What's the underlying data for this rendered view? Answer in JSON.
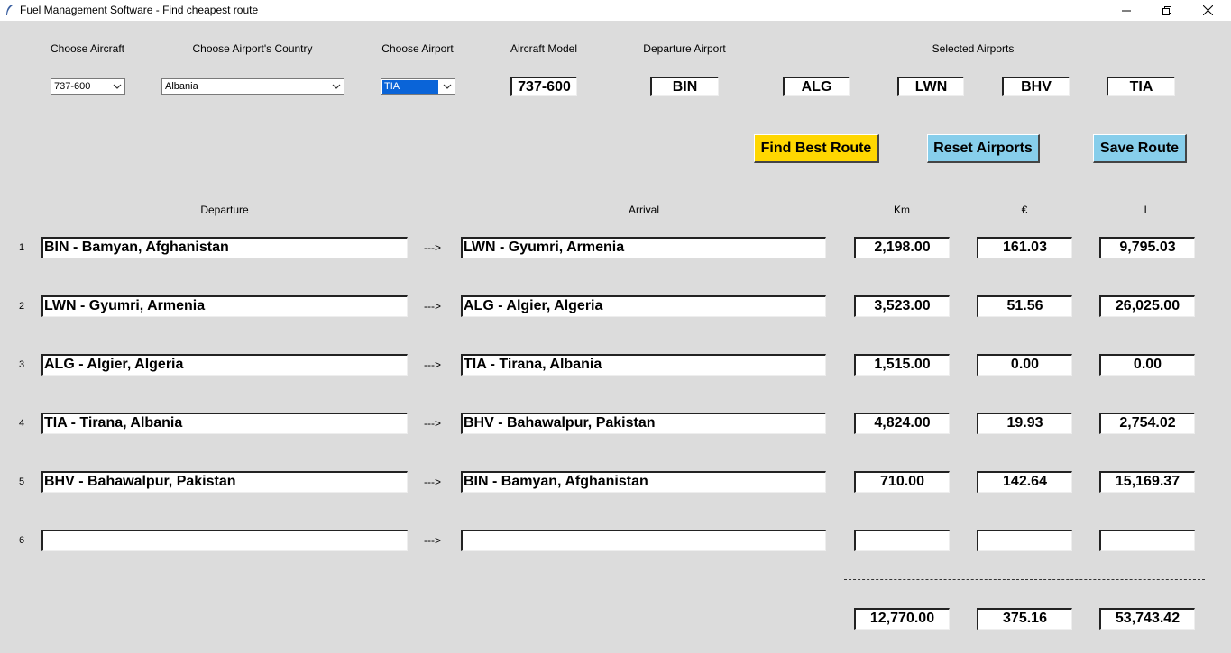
{
  "window": {
    "title": "Fuel Management Software - Find cheapest route"
  },
  "labels": {
    "choose_aircraft": "Choose Aircraft",
    "choose_country": "Choose Airport's Country",
    "choose_airport": "Choose Airport",
    "aircraft_model": "Aircraft Model",
    "departure_airport": "Departure Airport",
    "selected_airports": "Selected Airports"
  },
  "selectors": {
    "aircraft": "737-600",
    "country": "Albania",
    "airport": "TIA"
  },
  "aircraft_model_value": "737-600",
  "departure_airport_value": "BIN",
  "selected_airports": [
    "ALG",
    "LWN",
    "BHV",
    "TIA"
  ],
  "buttons": {
    "find_best_route": "Find Best Route",
    "reset_airports": "Reset Airports",
    "save_route": "Save Route"
  },
  "colors": {
    "find_best_route": "#ffd700",
    "reset_airports": "#87ceeb",
    "save_route": "#87ceeb"
  },
  "table": {
    "headers": {
      "departure": "Departure",
      "arrival": "Arrival",
      "km": "Km",
      "eur": "€",
      "l": "L"
    },
    "arrow": "--->",
    "rows": [
      {
        "num": "1",
        "departure": "BIN - Bamyan, Afghanistan",
        "arrival": "LWN - Gyumri, Armenia",
        "km": "2,198.00",
        "eur": "161.03",
        "l": "9,795.03"
      },
      {
        "num": "2",
        "departure": "LWN - Gyumri, Armenia",
        "arrival": "ALG - Algier, Algeria",
        "km": "3,523.00",
        "eur": "51.56",
        "l": "26,025.00"
      },
      {
        "num": "3",
        "departure": "ALG - Algier, Algeria",
        "arrival": "TIA - Tirana, Albania",
        "km": "1,515.00",
        "eur": "0.00",
        "l": "0.00"
      },
      {
        "num": "4",
        "departure": "TIA - Tirana, Albania",
        "arrival": "BHV - Bahawalpur, Pakistan",
        "km": "4,824.00",
        "eur": "19.93",
        "l": "2,754.02"
      },
      {
        "num": "5",
        "departure": "BHV - Bahawalpur, Pakistan",
        "arrival": "BIN - Bamyan, Afghanistan",
        "km": "710.00",
        "eur": "142.64",
        "l": "15,169.37"
      },
      {
        "num": "6",
        "departure": "",
        "arrival": "",
        "km": "",
        "eur": "",
        "l": ""
      }
    ],
    "totals": {
      "km": "12,770.00",
      "eur": "375.16",
      "l": "53,743.42"
    }
  }
}
